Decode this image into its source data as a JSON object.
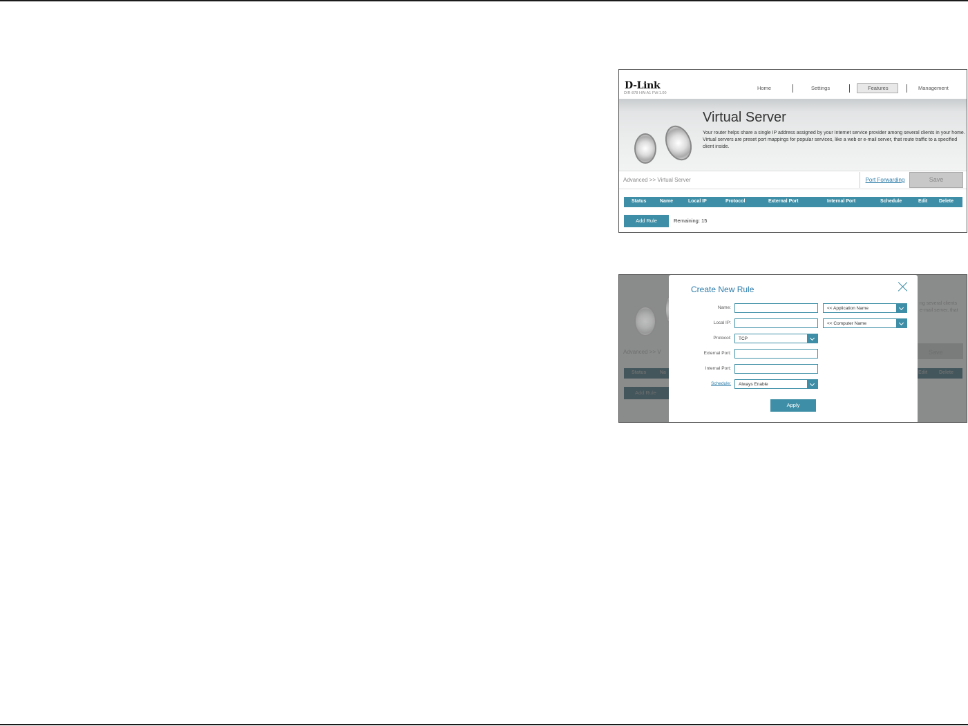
{
  "header": {
    "logo": "D-Link",
    "model": "DIR-878 HW:A1 FW:1.00",
    "nav": [
      "Home",
      "Settings",
      "Features",
      "Management"
    ],
    "active_nav": "Features"
  },
  "banner": {
    "title": "Virtual Server",
    "description": "Your router helps share a single IP address assigned by your Internet service provider among several clients in your home. Virtual servers are preset port mappings for popular services, like a web or e-mail server, that route traffic to a specified client inside."
  },
  "crumbbar": {
    "breadcrumb": "Advanced >> Virtual Server",
    "port_forwarding": "Port Forwarding",
    "save": "Save"
  },
  "table": {
    "headers": [
      "Status",
      "Name",
      "Local IP",
      "Protocol",
      "External Port",
      "Internal Port",
      "Schedule",
      "Edit",
      "Delete"
    ]
  },
  "actions": {
    "add_rule": "Add Rule",
    "remaining": "Remaining: 15"
  },
  "background_ghost": {
    "breadcrumb": "Advanced >> V",
    "desc_fragment_1": "ng several clients",
    "desc_fragment_2": "e-mail server, that",
    "save": "Save",
    "header_status": "Status",
    "header_name": "Na",
    "header_edit": "Edit",
    "header_delete": "Delete",
    "add_rule": "Add Rule"
  },
  "modal": {
    "title": "Create New Rule",
    "fields": {
      "name_label": "Name:",
      "name_value": "",
      "application_select": "<< Application Name",
      "local_ip_label": "Local IP:",
      "local_ip_value": "",
      "computer_select": "<< Computer Name",
      "protocol_label": "Protocol:",
      "protocol_value": "TCP",
      "external_port_label": "External Port:",
      "external_port_value": "",
      "internal_port_label": "Internal Port:",
      "internal_port_value": "",
      "schedule_label": "Schedule:",
      "schedule_value": "Always Enable"
    },
    "apply": "Apply"
  },
  "colors": {
    "accent": "#3d8ea6",
    "link": "#2a7aa8"
  }
}
